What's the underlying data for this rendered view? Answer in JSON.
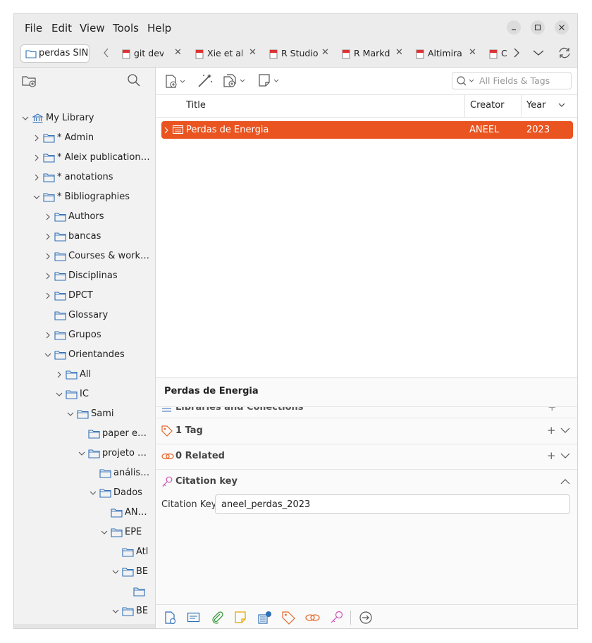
{
  "menu": [
    "File",
    "Edit",
    "View",
    "Tools",
    "Help"
  ],
  "window_controls": [
    "minimize-icon",
    "maximize-icon",
    "close-icon"
  ],
  "library_tab": "perdas SIN",
  "reader_tabs": [
    "git devel",
    "Xie et al.",
    "R Studio",
    "R Markd",
    "Altimira",
    "C"
  ],
  "tree": [
    {
      "label": "My Library",
      "level": 0,
      "twisty": "open",
      "icon": "library-icon"
    },
    {
      "label": "* Admin",
      "level": 1,
      "twisty": "closed"
    },
    {
      "label": "* Aleix publications…",
      "level": 1,
      "twisty": "closed"
    },
    {
      "label": "* anotations",
      "level": 1,
      "twisty": "closed"
    },
    {
      "label": "* Bibliographies",
      "level": 1,
      "twisty": "open"
    },
    {
      "label": "Authors",
      "level": 2,
      "twisty": "closed"
    },
    {
      "label": "bancas",
      "level": 2,
      "twisty": "closed"
    },
    {
      "label": "Courses & works…",
      "level": 2,
      "twisty": "closed"
    },
    {
      "label": "Disciplinas",
      "level": 2,
      "twisty": "closed"
    },
    {
      "label": "DPCT",
      "level": 2,
      "twisty": "closed"
    },
    {
      "label": "Glossary",
      "level": 2,
      "twisty": "none"
    },
    {
      "label": "Grupos",
      "level": 2,
      "twisty": "closed"
    },
    {
      "label": "Orientandes",
      "level": 2,
      "twisty": "open"
    },
    {
      "label": "All",
      "level": 3,
      "twisty": "closed"
    },
    {
      "label": "IC",
      "level": 3,
      "twisty": "open"
    },
    {
      "label": "Sami",
      "level": 4,
      "twisty": "open"
    },
    {
      "label": "paper e…",
      "level": 5,
      "twisty": "none"
    },
    {
      "label": "projeto …",
      "level": 5,
      "twisty": "open"
    },
    {
      "label": "anális…",
      "level": 6,
      "twisty": "none"
    },
    {
      "label": "Dados",
      "level": 6,
      "twisty": "open"
    },
    {
      "label": "AN…",
      "level": 7,
      "twisty": "none"
    },
    {
      "label": "EPE",
      "level": 7,
      "twisty": "open"
    },
    {
      "label": "Atl",
      "level": 8,
      "twisty": "none"
    },
    {
      "label": "BE",
      "level": 8,
      "twisty": "open"
    },
    {
      "label": "",
      "level": 9,
      "twisty": "none"
    },
    {
      "label": "BE",
      "level": 8,
      "twisty": "open"
    },
    {
      "label": "",
      "level": 9,
      "twisty": "open"
    }
  ],
  "search": {
    "placeholder": "All Fields & Tags"
  },
  "columns": {
    "title": "Title",
    "creator": "Creator",
    "year": "Year"
  },
  "items": [
    {
      "title": "Perdas de Energia",
      "creator": "ANEEL",
      "year": "2023",
      "selected": true
    }
  ],
  "item_pane": {
    "title": "Perdas de Energia",
    "libraries_section": "Libraries and Collections",
    "tags_section": "1 Tag",
    "related_section": "0 Related",
    "citation_section": "Citation key",
    "citation_label": "Citation Key",
    "citation_value": "aneel_perdas_2023"
  },
  "colors": {
    "accent": "#e95420",
    "sidebar_bg": "#f2f2f2",
    "menubar_bg": "#ececec"
  }
}
